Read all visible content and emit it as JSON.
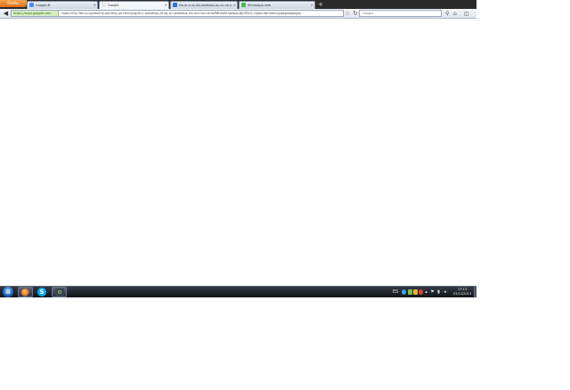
{
  "browser": {
    "menu_label": "Firefox",
    "tabs": [
      {
        "title": "Google-N",
        "favicon_color": "#4a8df0",
        "active": false
      },
      {
        "title": "Google",
        "favicon_color": "#e8e8e8",
        "active": true
      },
      {
        "title": "De-er-e-ss-ies-dadkoss-os-co-ne-ies",
        "favicon_color": "#2f6fd0",
        "active": false
      },
      {
        "title": "WhatsApp web",
        "favicon_color": "#3fbf4f",
        "active": false
      }
    ],
    "new_tab_glyph": "+",
    "close_glyph": "×",
    "identity_label": "https://www.google.com",
    "url": "/search?q=fbs-q=guidshrie-aanthsy-olrcfinnkpspm-n-aiosdhgs-Af-eg-m-ukatwlsis-kls-mo+sm-KrliaPBIVAKILsblbpq-BJCPAO1-nDlpt-kbrlidsliuiyqagaqipqlgss",
    "search_text": "Google",
    "icons": {
      "back": "back-arrow-icon",
      "star": "star-icon",
      "reload": "reload-icon",
      "search_go": "search-icon",
      "home": "home-icon",
      "addon": "addon-icon"
    }
  },
  "taskbar": {
    "start_glyph": "⊞",
    "apps": [
      {
        "name": "firefox",
        "icon": "firefox-icon"
      },
      {
        "name": "skype",
        "icon": "skype-icon",
        "glyph": "S"
      },
      {
        "name": "utility",
        "icon": "gear-icon",
        "glyph": "⚙"
      }
    ],
    "tray": {
      "lang": "ES",
      "flag_glyph": "⚑",
      "net_glyph": "▮",
      "vol_glyph": "◂"
    },
    "clock_time": "17:13",
    "clock_date": "03/12/2013"
  }
}
